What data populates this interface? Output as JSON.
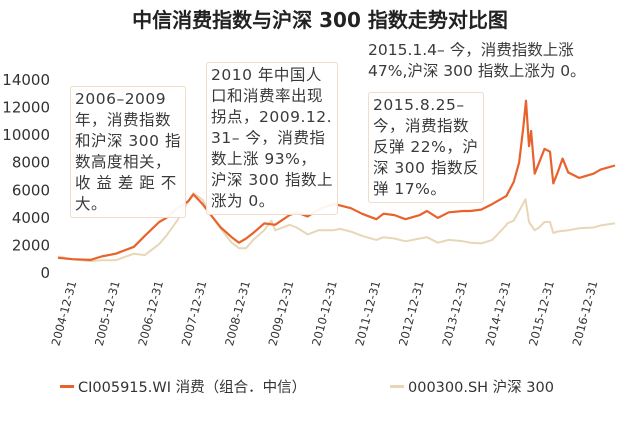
{
  "chart_data": {
    "type": "line",
    "title": "中信消费指数与沪深 300 指数走势对比图",
    "xlabel": "",
    "ylabel": "",
    "ylim": [
      0,
      14000
    ],
    "y_ticks": [
      "0",
      "2000",
      "4000",
      "6000",
      "8000",
      "10000",
      "12000",
      "14000"
    ],
    "y_tick_values": [
      0,
      2000,
      4000,
      6000,
      8000,
      10000,
      12000,
      14000
    ],
    "x_range": [
      "2004-09-01",
      "2017-06-30"
    ],
    "x_tick_labels": [
      "2004-12-31",
      "2005-12-31",
      "2006-12-31",
      "2007-12-31",
      "2008-12-31",
      "2009-12-31",
      "2010-12-31",
      "2011-12-31",
      "2012-12-31",
      "2013-12-31",
      "2014-12-31",
      "2015-12-31",
      "2016-12-31"
    ],
    "grid": false,
    "legend_position": "bottom",
    "series": [
      {
        "name": "CI005915.WI 消费（组合．中信）",
        "color": "#e8622c",
        "points": [
          [
            "2004-09-01",
            1100
          ],
          [
            "2004-12-31",
            1000
          ],
          [
            "2005-06-01",
            950
          ],
          [
            "2005-09-01",
            1200
          ],
          [
            "2005-12-31",
            1400
          ],
          [
            "2006-06-01",
            1900
          ],
          [
            "2006-09-01",
            2700
          ],
          [
            "2006-12-31",
            3700
          ],
          [
            "2007-03-01",
            4000
          ],
          [
            "2007-06-01",
            4700
          ],
          [
            "2007-09-01",
            5200
          ],
          [
            "2007-10-15",
            5700
          ],
          [
            "2007-12-31",
            5000
          ],
          [
            "2008-03-01",
            4300
          ],
          [
            "2008-06-01",
            3300
          ],
          [
            "2008-09-01",
            2600
          ],
          [
            "2008-11-01",
            2200
          ],
          [
            "2008-12-31",
            2500
          ],
          [
            "2009-03-01",
            2900
          ],
          [
            "2009-06-01",
            3600
          ],
          [
            "2009-09-01",
            3500
          ],
          [
            "2009-12-31",
            4200
          ],
          [
            "2010-03-01",
            4400
          ],
          [
            "2010-06-01",
            4100
          ],
          [
            "2010-09-01",
            4600
          ],
          [
            "2010-12-31",
            5000
          ],
          [
            "2011-03-01",
            4900
          ],
          [
            "2011-06-01",
            4700
          ],
          [
            "2011-09-01",
            4300
          ],
          [
            "2011-12-31",
            3900
          ],
          [
            "2012-03-01",
            4300
          ],
          [
            "2012-06-01",
            4200
          ],
          [
            "2012-09-01",
            3900
          ],
          [
            "2012-12-31",
            4200
          ],
          [
            "2013-03-01",
            4500
          ],
          [
            "2013-06-01",
            4000
          ],
          [
            "2013-09-01",
            4400
          ],
          [
            "2013-12-31",
            4500
          ],
          [
            "2014-03-01",
            4500
          ],
          [
            "2014-06-01",
            4600
          ],
          [
            "2014-09-01",
            5000
          ],
          [
            "2014-12-31",
            5600
          ],
          [
            "2015-01-05",
            5700
          ],
          [
            "2015-03-01",
            6600
          ],
          [
            "2015-04-15",
            8000
          ],
          [
            "2015-05-20",
            10500
          ],
          [
            "2015-06-12",
            12500
          ],
          [
            "2015-07-08",
            9200
          ],
          [
            "2015-07-25",
            10300
          ],
          [
            "2015-08-25",
            7200
          ],
          [
            "2015-10-01",
            8000
          ],
          [
            "2015-11-15",
            9000
          ],
          [
            "2015-12-31",
            8800
          ],
          [
            "2016-01-28",
            6500
          ],
          [
            "2016-03-01",
            7200
          ],
          [
            "2016-04-15",
            8300
          ],
          [
            "2016-06-01",
            7300
          ],
          [
            "2016-09-01",
            6900
          ],
          [
            "2016-12-31",
            7200
          ],
          [
            "2017-03-01",
            7500
          ],
          [
            "2017-06-30",
            7800
          ]
        ]
      },
      {
        "name": "000300.SH 沪深 300",
        "color": "#e8d6b8",
        "points": [
          [
            "2004-09-01",
            1200
          ],
          [
            "2004-12-31",
            1000
          ],
          [
            "2005-06-01",
            850
          ],
          [
            "2005-09-01",
            930
          ],
          [
            "2005-12-31",
            930
          ],
          [
            "2006-06-01",
            1400
          ],
          [
            "2006-09-01",
            1300
          ],
          [
            "2006-12-31",
            2100
          ],
          [
            "2007-03-01",
            2700
          ],
          [
            "2007-06-01",
            3800
          ],
          [
            "2007-09-01",
            5200
          ],
          [
            "2007-10-15",
            5800
          ],
          [
            "2007-12-31",
            5300
          ],
          [
            "2008-03-01",
            4300
          ],
          [
            "2008-06-01",
            3200
          ],
          [
            "2008-09-01",
            2200
          ],
          [
            "2008-11-01",
            1800
          ],
          [
            "2008-12-31",
            1800
          ],
          [
            "2009-03-01",
            2400
          ],
          [
            "2009-06-01",
            3100
          ],
          [
            "2009-08-01",
            3800
          ],
          [
            "2009-09-01",
            3100
          ],
          [
            "2009-12-31",
            3500
          ],
          [
            "2010-03-01",
            3300
          ],
          [
            "2010-06-01",
            2800
          ],
          [
            "2010-09-01",
            3100
          ],
          [
            "2010-12-31",
            3100
          ],
          [
            "2011-03-01",
            3200
          ],
          [
            "2011-06-01",
            3000
          ],
          [
            "2011-09-01",
            2700
          ],
          [
            "2011-12-31",
            2400
          ],
          [
            "2012-03-01",
            2600
          ],
          [
            "2012-06-01",
            2500
          ],
          [
            "2012-09-01",
            2300
          ],
          [
            "2012-12-31",
            2500
          ],
          [
            "2013-03-01",
            2600
          ],
          [
            "2013-06-01",
            2200
          ],
          [
            "2013-09-01",
            2400
          ],
          [
            "2013-12-31",
            2300
          ],
          [
            "2014-03-01",
            2200
          ],
          [
            "2014-06-01",
            2150
          ],
          [
            "2014-09-01",
            2400
          ],
          [
            "2014-12-31",
            3500
          ],
          [
            "2015-01-05",
            3600
          ],
          [
            "2015-03-01",
            3800
          ],
          [
            "2015-04-15",
            4500
          ],
          [
            "2015-06-08",
            5350
          ],
          [
            "2015-07-08",
            3700
          ],
          [
            "2015-08-25",
            3100
          ],
          [
            "2015-10-01",
            3300
          ],
          [
            "2015-11-15",
            3700
          ],
          [
            "2015-12-31",
            3700
          ],
          [
            "2016-01-28",
            2900
          ],
          [
            "2016-03-01",
            3000
          ],
          [
            "2016-06-01",
            3100
          ],
          [
            "2016-09-01",
            3250
          ],
          [
            "2016-12-31",
            3300
          ],
          [
            "2017-03-01",
            3450
          ],
          [
            "2017-06-30",
            3600
          ]
        ]
      }
    ]
  },
  "annotations": {
    "note_2006_2009": "2006–2009\n年，消费指数\n和沪深 300 指\n数高度相关，\n收 益 差 距 不\n大。",
    "note_2010": "2010 年中国人\n口和消费率出现\n拐点，2009.12.\n31– 今，消费指\n数上涨 93%，\n沪深 300 指数上\n涨为 0。",
    "note_2015_1_4": "2015.1.4– 今，消费指数上涨\n47%,沪深 300 指数上涨为 0。",
    "note_2015_8_25": "2015.8.25–\n今，消费指数\n反弹 22%，沪\n深 300 指数反\n弹 17%。"
  }
}
